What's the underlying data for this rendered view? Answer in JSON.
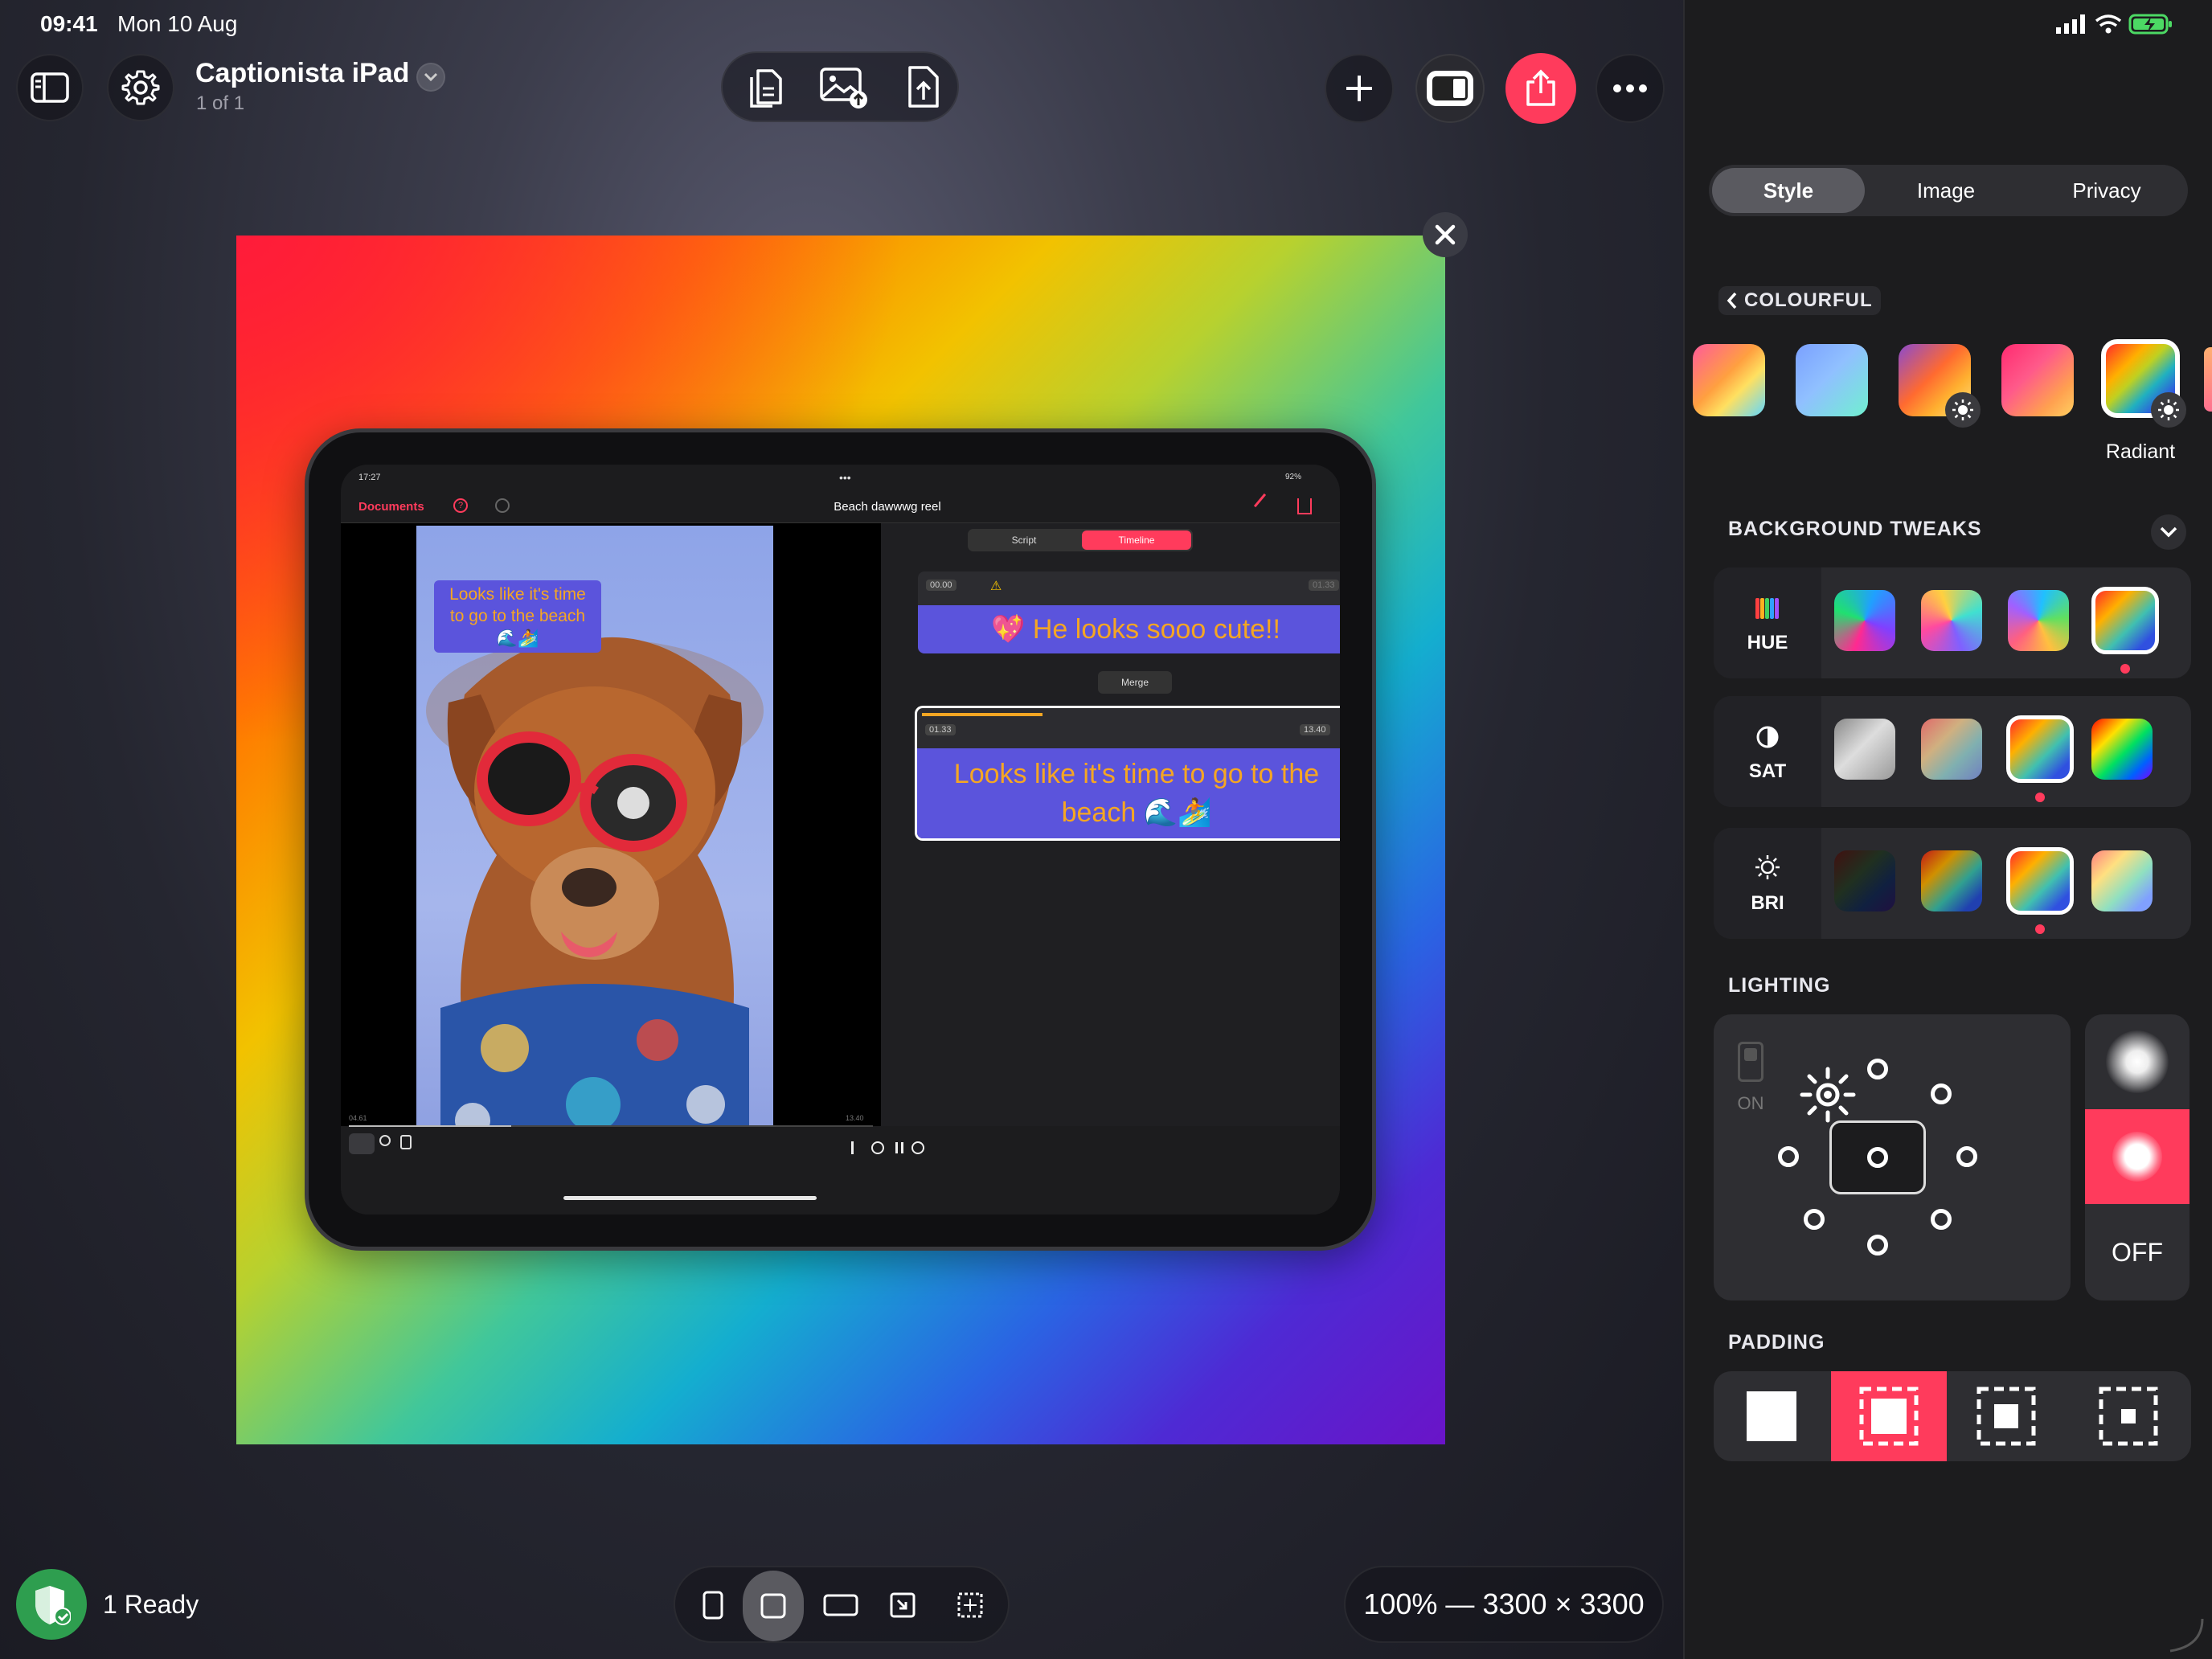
{
  "status_bar": {
    "time": "09:41",
    "date": "Mon 10 Aug"
  },
  "document": {
    "title": "Captionista iPad",
    "subtitle": "1 of 1"
  },
  "bottom_bar": {
    "ready_label": "1 Ready",
    "zoom_info": "100% — 3300 × 3300"
  },
  "inner_app": {
    "time": "17:27",
    "battery": "92%",
    "back_label": "Documents",
    "title": "Beach dawwwg reel",
    "tabs": [
      "Script",
      "Timeline"
    ],
    "video_caption": "Looks like it's time to go to the beach 🌊🏄",
    "clip1": {
      "start": "00.00",
      "end": "01.33",
      "text": "💖 He looks sooo cute!!"
    },
    "merge_label": "Merge",
    "clip2": {
      "start": "01.33",
      "end": "13.40",
      "text": "Looks like it's time to go to the beach 🌊🏄"
    },
    "scrub_start": "04.61",
    "scrub_end": "13.40",
    "scrub_progress": 0.31
  },
  "panel": {
    "tabs": [
      "Style",
      "Image",
      "Privacy"
    ],
    "active_tab": "Style",
    "category": "COLOURFUL",
    "selected_preset": "Radiant",
    "background_tweaks_label": "BACKGROUND TWEAKS",
    "hue_label": "HUE",
    "sat_label": "SAT",
    "bri_label": "BRI",
    "lighting_label": "LIGHTING",
    "lighting_on_label": "ON",
    "lighting_off_label": "OFF",
    "padding_label": "PADDING"
  },
  "colors": {
    "accent": "#ff3b5c",
    "caption_bg": "#5b54dc",
    "caption_text": "#f5a623",
    "panel_bg": "#1c1c1e"
  }
}
